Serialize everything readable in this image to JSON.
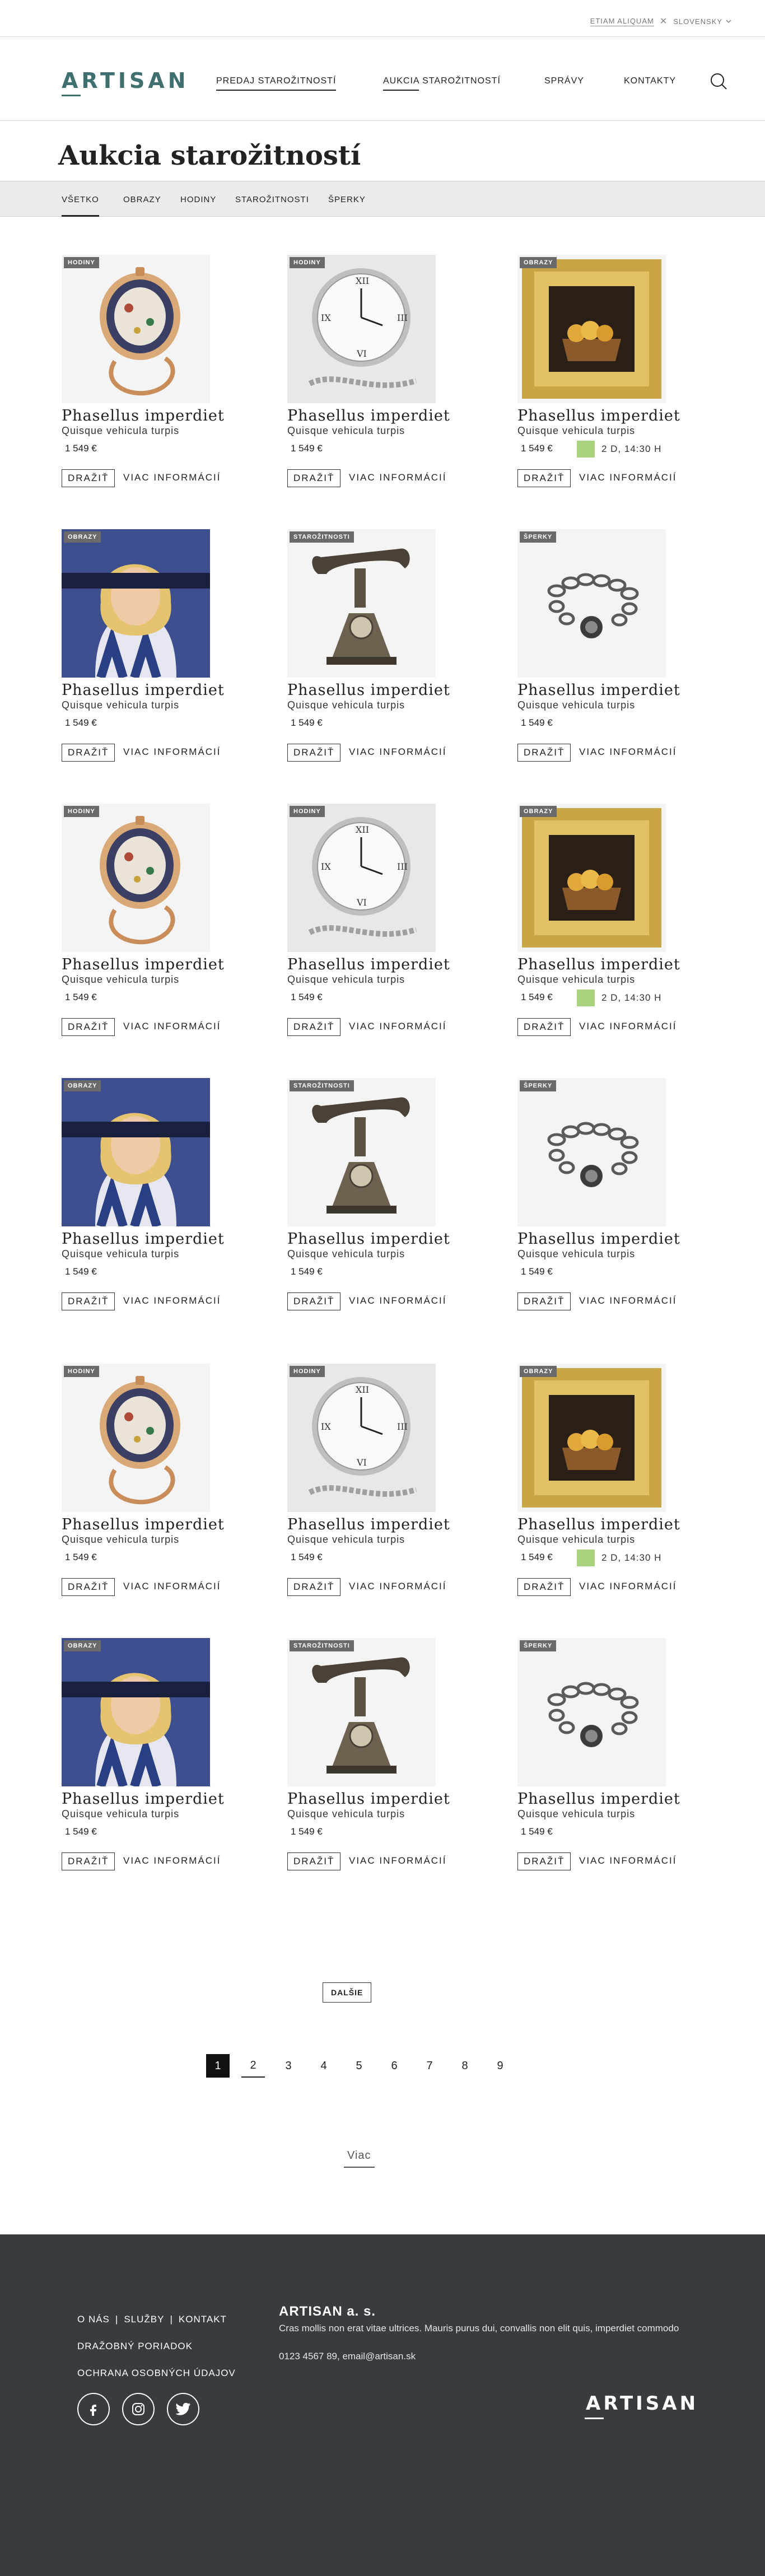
{
  "topbar": {
    "promo_link": "ETIAM ALIQUAM",
    "close_icon": "close-icon",
    "language": "SLOVENSKY",
    "language_chevron": "chevron-down-icon"
  },
  "header": {
    "logo": "ARTISAN",
    "nav": [
      {
        "label": "PREDAJ STAROŽITNOSTÍ"
      },
      {
        "label": "AUKCIA STAROŽITNOSTÍ"
      },
      {
        "label": "SPRÁVY"
      },
      {
        "label": "KONTAKTY"
      }
    ],
    "search_icon": "search-icon"
  },
  "page": {
    "title": "Aukcia starožitností"
  },
  "tabs": [
    "VŠETKO",
    "OBRAZY",
    "HODINY",
    "STAROŽITNOSTI",
    "ŠPERKY"
  ],
  "product": {
    "name": "Phasellus imperdiet",
    "subtitle": "Quisque vehicula turpis",
    "price": "1 549 €",
    "bid_label": "DRAŽIŤ",
    "more_label": "VIAC INFORMÁCIÍ",
    "countdown": "2 D, 14:30 H",
    "countdown_color": "#a9d27d"
  },
  "categories": {
    "hodiny": "HODINY",
    "obrazy": "OBRAZY",
    "starozitnosti": "STAROŽITNOSTI",
    "sperky": "ŠPERKY"
  },
  "grid_rows": [
    [
      "pocket-watch-gold",
      "pocket-watch-silver",
      "framed-painting"
    ],
    [
      "portrait-painting",
      "antique-telephone",
      "chain-bracelet"
    ],
    [
      "pocket-watch-gold",
      "pocket-watch-silver",
      "framed-painting"
    ],
    [
      "portrait-painting",
      "antique-telephone",
      "chain-bracelet"
    ],
    [
      "pocket-watch-gold",
      "pocket-watch-silver",
      "framed-painting"
    ],
    [
      "portrait-painting",
      "antique-telephone",
      "chain-bracelet"
    ]
  ],
  "load_more": "DALŠIE",
  "pagination": [
    "1",
    "2",
    "3",
    "4",
    "5",
    "6",
    "7",
    "8",
    "9"
  ],
  "current_page": "1",
  "viac_link": "Viac",
  "footer": {
    "links": [
      "O NÁS",
      "SLUŽBY",
      "KONTAKT",
      "DRAŽOBNÝ PORIADOK",
      "OCHRANA OSOBNÝCH ÚDAJOV"
    ],
    "separator": "|",
    "company_name": "ARTISAN a. s.",
    "company_desc": "Cras mollis non erat vitae ultrices. Mauris purus dui, convallis non elit quis, imperdiet commodo",
    "contact": "0123 4567 89, email@artisan.sk",
    "social": [
      "facebook-icon",
      "instagram-icon",
      "twitter-icon"
    ],
    "logo": "ARTISAN"
  },
  "colors": {
    "brand": "#3f6f6f",
    "footer_bg": "#383c3f",
    "tab_bg": "#ebebeb",
    "badge_bg": "#6a6a6a"
  }
}
